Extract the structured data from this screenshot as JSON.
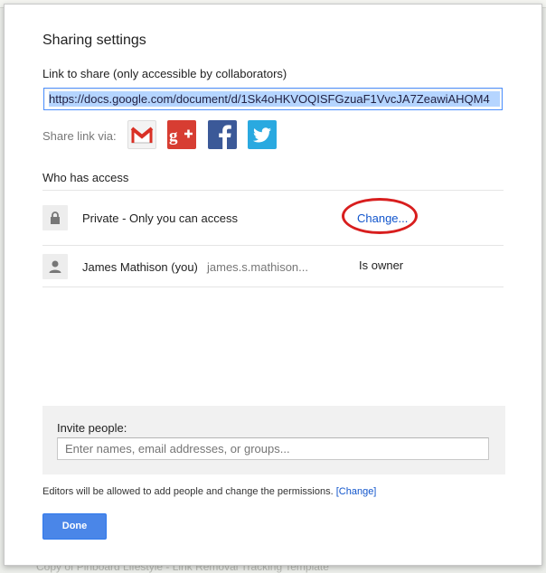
{
  "dialog": {
    "title": "Sharing settings",
    "link_label": "Link to share (only accessible by collaborators)",
    "link_value": "https://docs.google.com/document/d/1Sk4oHKVOQISFGzuaF1VvcJA7ZeawiAHQM4",
    "share_via_label": "Share link via:",
    "share_icons": [
      "gmail-icon",
      "google-plus-icon",
      "facebook-icon",
      "twitter-icon"
    ],
    "who_has_access_label": "Who has access",
    "access_rows": [
      {
        "icon": "lock-icon",
        "name": "Private - Only you can access",
        "action": "Change..."
      },
      {
        "icon": "person-icon",
        "name": "James Mathison (you)",
        "email": "james.s.mathison...",
        "role": "Is owner"
      }
    ],
    "invite": {
      "label": "Invite people:",
      "placeholder": "Enter names, email addresses, or groups..."
    },
    "editors_note": "Editors will be allowed to add people and change the permissions.",
    "editors_change_link": "[Change]",
    "done_label": "Done"
  },
  "background": {
    "bottom_text": "Copy of Pinboard Lifestyle - Link Removal Tracking Template"
  },
  "colors": {
    "accent": "#4a86e8",
    "link": "#1155cc",
    "highlight": "#d81e1e"
  }
}
